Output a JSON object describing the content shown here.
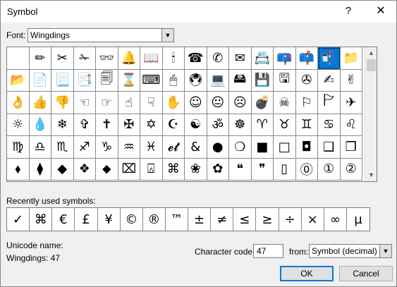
{
  "window": {
    "title": "Symbol",
    "help_glyph": "?",
    "close_glyph": "✕"
  },
  "font": {
    "label": "Font:",
    "value": "Wingdings"
  },
  "symbol_grid": {
    "selected_index": 14,
    "rows": [
      [
        "",
        "✏",
        "✂",
        "✁",
        "👓",
        "🔔",
        "📖",
        "🕯",
        "☎",
        "✆",
        "✉",
        "📇",
        "📪",
        "📫",
        "📬",
        "📁"
      ],
      [
        "📂",
        "📄",
        "📃",
        "📑",
        "🗐",
        "⌛",
        "⌨",
        "🖱",
        "🖲",
        "💻",
        "🖴",
        "💾",
        "🖫",
        "✇",
        "✍",
        "✌"
      ],
      [
        "👌",
        "👍",
        "👎",
        "☜",
        "☞",
        "☝",
        "☟",
        "✋",
        "☺",
        "😐",
        "☹",
        "💣",
        "☠",
        "⚐",
        "🏱",
        "✈"
      ],
      [
        "☼",
        "💧",
        "❄",
        "✞",
        "✝",
        "✠",
        "✡",
        "☪",
        "☯",
        "ॐ",
        "☸",
        "♈",
        "♉",
        "♊",
        "♋",
        "♌"
      ],
      [
        "♍",
        "♎",
        "♏",
        "♐",
        "♑",
        "♒",
        "♓",
        "𝓮𝓽",
        "&",
        "●",
        "❍",
        "■",
        "□",
        "◘",
        "❑",
        "❒"
      ],
      [
        "⬧",
        "⧫",
        "◆",
        "❖",
        "⬥",
        "⌧",
        "⍓",
        "⌘",
        "❀",
        "✿",
        "❝",
        "❞",
        "▯",
        "⓪",
        "①",
        "②"
      ]
    ]
  },
  "recent": {
    "label": "Recently used symbols:",
    "items": [
      "✓",
      "⌘",
      "€",
      "£",
      "¥",
      "©",
      "®",
      "™",
      "±",
      "≠",
      "≤",
      "≥",
      "÷",
      "×",
      "∞",
      "µ"
    ]
  },
  "unicode": {
    "label": "Unicode name:",
    "value": "Wingdings: 47"
  },
  "character_code": {
    "label": "Character code:",
    "value": "47"
  },
  "from": {
    "label": "from:",
    "value": "Symbol (decimal)"
  },
  "buttons": {
    "ok": "OK",
    "cancel": "Cancel"
  }
}
